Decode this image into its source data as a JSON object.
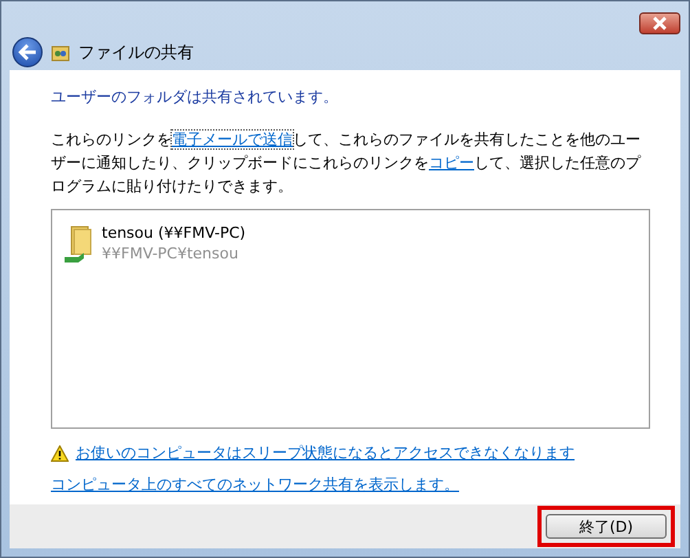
{
  "window": {
    "title": "ファイルの共有"
  },
  "heading": "ユーザーのフォルダは共有されています。",
  "intro": [
    {
      "kind": "plain",
      "text": "これらのリンクを"
    },
    {
      "kind": "link",
      "text": "電子メールで送信",
      "focused": true
    },
    {
      "kind": "plain",
      "text": "して、これらのファイルを共有したことを他のユーザーに通知したり、クリップボードにこれらのリンクを"
    },
    {
      "kind": "link",
      "text": "コピー",
      "focused": false
    },
    {
      "kind": "plain",
      "text": "して、選択した任意のプログラムに貼り付けたりできます。"
    }
  ],
  "shares": [
    {
      "name": "tensou (¥¥FMV-PC)",
      "path": "¥¥FMV-PC¥tensou"
    }
  ],
  "links": [
    {
      "kind": "warning",
      "text": "お使いのコンピュータはスリープ状態になるとアクセスできなくなります"
    },
    {
      "kind": "plain",
      "text": "コンピュータ上のすべてのネットワーク共有を表示します。"
    }
  ],
  "button": {
    "label": "終了(D)",
    "highlighted": true
  }
}
